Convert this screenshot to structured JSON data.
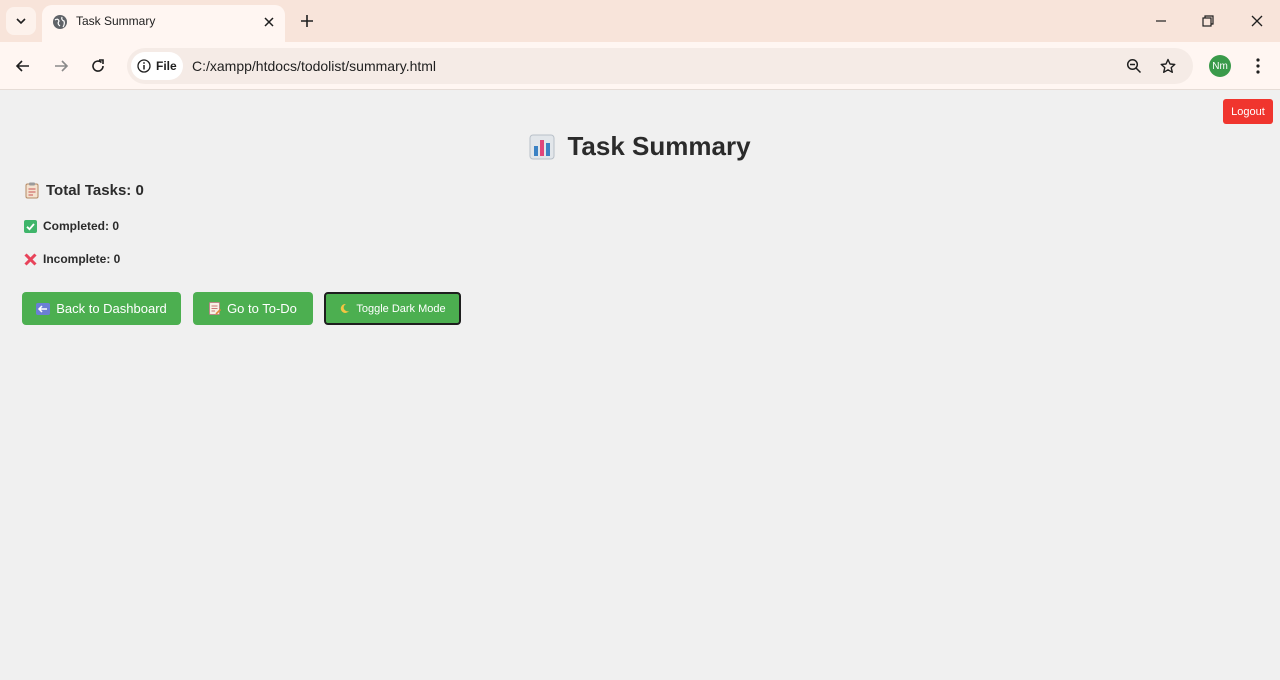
{
  "browser": {
    "tab": {
      "title": "Task Summary"
    },
    "address_bar": {
      "site_chip_label": "File",
      "url": "C:/xampp/htdocs/todolist/summary.html"
    },
    "profile_initials": "Nm"
  },
  "page": {
    "logout_label": "Logout",
    "title": "Task Summary",
    "title_icon": "bar-chart-icon",
    "stats": {
      "total": {
        "icon": "clipboard-icon",
        "text": "Total Tasks: 0"
      },
      "completed": {
        "icon": "check-mark-icon",
        "text": "Completed: 0"
      },
      "incomplete": {
        "icon": "cross-mark-icon",
        "text": "Incomplete: 0"
      }
    },
    "buttons": {
      "back": {
        "icon": "back-arrow-icon",
        "label": "Back to Dashboard"
      },
      "todo": {
        "icon": "memo-icon",
        "label": "Go to To-Do"
      },
      "dark": {
        "icon": "moon-icon",
        "label": "Toggle Dark Mode"
      }
    }
  },
  "colors": {
    "accent_green": "#4caf50",
    "logout_red": "#f0352e",
    "page_bg": "#f0f0f0",
    "tabbar_bg": "#f8e4da"
  }
}
